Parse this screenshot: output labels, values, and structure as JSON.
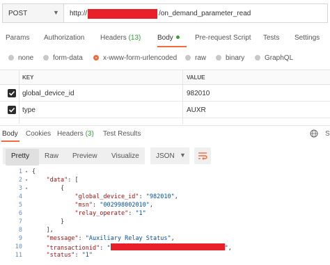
{
  "request": {
    "method": "POST",
    "url_prefix": "http://",
    "url_suffix": "/on_demand_parameter_read"
  },
  "request_tabs": [
    {
      "label": "Params"
    },
    {
      "label": "Authorization"
    },
    {
      "label": "Headers",
      "count": "(13)"
    },
    {
      "label": "Body"
    },
    {
      "label": "Pre-request Script"
    },
    {
      "label": "Tests"
    },
    {
      "label": "Settings"
    }
  ],
  "body_types": [
    "none",
    "form-data",
    "x-www-form-urlencoded",
    "raw",
    "binary",
    "GraphQL"
  ],
  "body_selected": "x-www-form-urlencoded",
  "kv_table": {
    "key_header": "KEY",
    "value_header": "VALUE",
    "rows": [
      {
        "key": "global_device_id",
        "value": "982010",
        "checked": true
      },
      {
        "key": "type",
        "value": "AUXR",
        "checked": true
      }
    ]
  },
  "response_tabs": [
    {
      "label": "Body"
    },
    {
      "label": "Cookies"
    },
    {
      "label": "Headers",
      "count": "(3)"
    },
    {
      "label": "Test Results"
    }
  ],
  "format_buttons": [
    "Pretty",
    "Raw",
    "Preview",
    "Visualize"
  ],
  "format_selected": "JSON",
  "code": {
    "line_numbers": [
      "1",
      "2",
      "3",
      "4",
      "5",
      "6",
      "7",
      "8",
      "9",
      "10",
      "11"
    ],
    "data_key": "\"data\"",
    "global_device_id_key": "\"global_device_id\"",
    "global_device_id_val": "\"982010\"",
    "msn_key": "\"msn\"",
    "msn_val": "\"002998002010\"",
    "relay_operate_key": "\"relay_operate\"",
    "relay_operate_val": "\"1\"",
    "message_key": "\"message\"",
    "message_val": "\"Auxiliary Relay Status\"",
    "transactionid_key": "\"transactionid\"",
    "transactionid_prefix": "\"",
    "transactionid_suffix": "\"",
    "status_key": "\"status\"",
    "status_val": "\"1\""
  },
  "colors": {
    "accent": "#f26b3a",
    "redaction": "#e8202a",
    "count_green": "#3a9c3a"
  }
}
